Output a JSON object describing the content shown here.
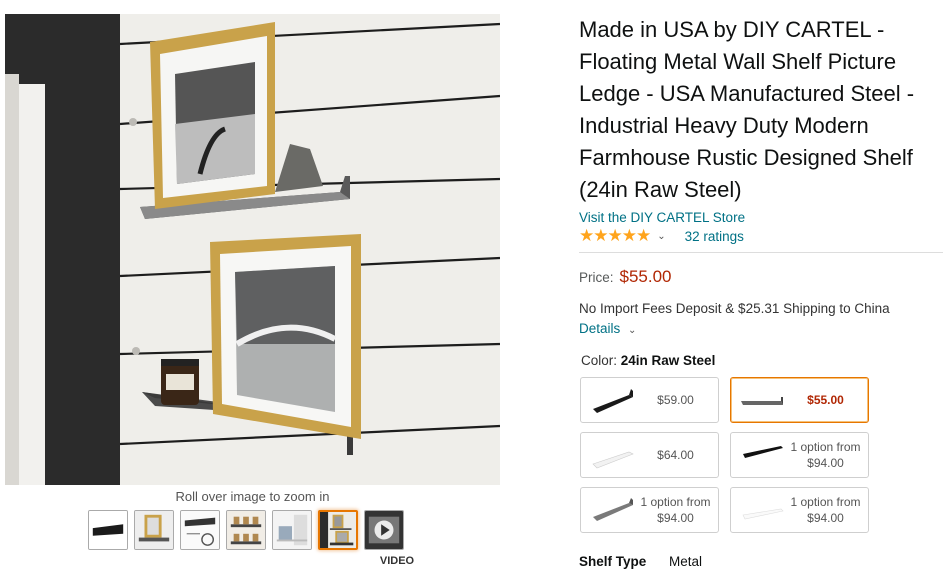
{
  "image": {
    "zoom_hint": "Roll over image to zoom in",
    "video_label": "VIDEO",
    "thumbnails": [
      {
        "name": "thumb-shelf-black"
      },
      {
        "name": "thumb-shelf-frame"
      },
      {
        "name": "thumb-shelf-dimensions"
      },
      {
        "name": "thumb-shelf-jars"
      },
      {
        "name": "thumb-shelf-white"
      },
      {
        "name": "thumb-shelf-frames-wall",
        "selected": true
      },
      {
        "name": "thumb-video"
      }
    ]
  },
  "product": {
    "title": "Made in USA by DIY CARTEL - Floating Metal Wall Shelf Picture Ledge - USA Manufactured Steel - Industrial Heavy Duty Modern Farmhouse Rustic Designed Shelf (24in Raw Steel)",
    "store_link": "Visit the DIY CARTEL Store",
    "stars": "★★★★★",
    "rating_value": 5,
    "ratings_count": "32 ratings",
    "price_label": "Price:",
    "price": "$55.00",
    "shipping_text": "No Import Fees Deposit & $25.31 Shipping to China",
    "details_link": "Details",
    "color_label": "Color:",
    "color_value": "24in Raw Steel",
    "swatches": [
      {
        "line1": "$59.00",
        "line2": "",
        "color": "#1a1a1a",
        "selected": false
      },
      {
        "line1": "$55.00",
        "line2": "",
        "color": "#555555",
        "selected": true
      },
      {
        "line1": "$64.00",
        "line2": "",
        "color": "#f2f2f2",
        "selected": false
      },
      {
        "line1": "1 option from",
        "line2": "$94.00",
        "color": "#111111",
        "selected": false
      },
      {
        "line1": "1 option from",
        "line2": "$94.00",
        "color": "#7a7a7a",
        "selected": false
      },
      {
        "line1": "1 option from",
        "line2": "$94.00",
        "color": "#fafafa",
        "selected": false
      }
    ],
    "shelf_type_label": "Shelf Type",
    "shelf_type_value": "Metal"
  },
  "colors": {
    "link": "#007185",
    "price": "#B12704",
    "star": "#FFA41C",
    "selected_border": "#e77600"
  }
}
